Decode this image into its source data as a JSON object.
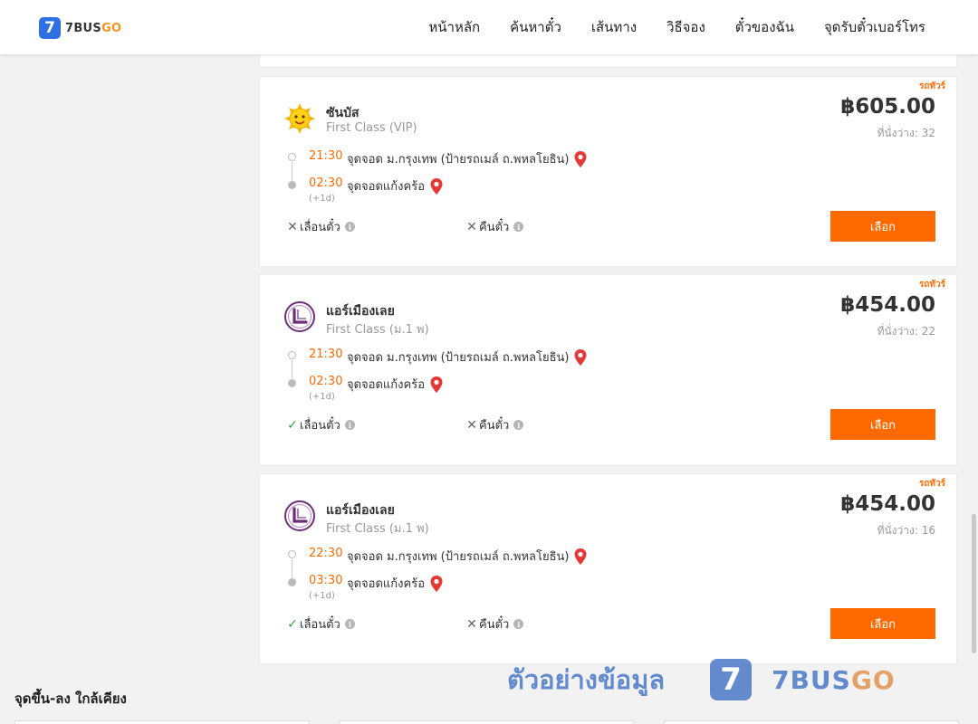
{
  "header": {
    "logo_mark": "7",
    "logo_text_a": "7BUS",
    "logo_text_b": "GO",
    "nav": [
      "หน้าหลัก",
      "ค้นหาตั๋ว",
      "เส้นทาง",
      "วิธีจอง",
      "ตั๋วของฉัน",
      "จุดรับตั๋วเบอร์โทร"
    ]
  },
  "trips": [
    {
      "tag": "รถทัวร์",
      "operator": "ซันบัส",
      "class": "First Class (VIP)",
      "logo_icon": "sun-logo-icon",
      "price": "฿605.00",
      "seats": "ที่นั่งว่าง: 32",
      "dep_time": "21:30",
      "dep_place": "จุดจอด ม.กรุงเทพ (ป้ายรถเมล์ ถ.พหลโยธิน)",
      "arr_time": "02:30",
      "arr_place": "จุดจอดแก้งคร้อ",
      "day_offset": "(+1d)",
      "change_label": "เลื่อนตั๋ว",
      "change_ok": false,
      "refund_label": "คืนตั๋ว",
      "refund_ok": false,
      "button": "เลือก"
    },
    {
      "tag": "รถทัวร์",
      "operator": "แอร์เมืองเลย",
      "class": "First Class (ม.1 พ)",
      "logo_icon": "air-muangloei-logo-icon",
      "price": "฿454.00",
      "seats": "ที่นั่งว่าง: 22",
      "dep_time": "21:30",
      "dep_place": "จุดจอด ม.กรุงเทพ (ป้ายรถเมล์ ถ.พหลโยธิน)",
      "arr_time": "02:30",
      "arr_place": "จุดจอดแก้งคร้อ",
      "day_offset": "(+1d)",
      "change_label": "เลื่อนตั๋ว",
      "change_ok": true,
      "refund_label": "คืนตั๋ว",
      "refund_ok": false,
      "button": "เลือก"
    },
    {
      "tag": "รถทัวร์",
      "operator": "แอร์เมืองเลย",
      "class": "First Class (ม.1 พ)",
      "logo_icon": "air-muangloei-logo-icon",
      "price": "฿454.00",
      "seats": "ที่นั่งว่าง: 16",
      "dep_time": "22:30",
      "dep_place": "จุดจอด ม.กรุงเทพ (ป้ายรถเมล์ ถ.พหลโยธิน)",
      "arr_time": "03:30",
      "arr_place": "จุดจอดแก้งคร้อ",
      "day_offset": "(+1d)",
      "change_label": "เลื่อนตั๋ว",
      "change_ok": true,
      "refund_label": "คืนตั๋ว",
      "refund_ok": false,
      "button": "เลือก"
    }
  ],
  "nearby_title": "จุดขึ้น-ลง ใกล้เคียง",
  "watermark": {
    "text": "ตัวอย่างข้อมูล",
    "logo_mark": "7",
    "brand_a": "7BUS",
    "brand_b": "GO"
  },
  "colors": {
    "accent": "#ff6a00",
    "brand_blue": "#2f6fe4",
    "check": "#2ea043"
  }
}
